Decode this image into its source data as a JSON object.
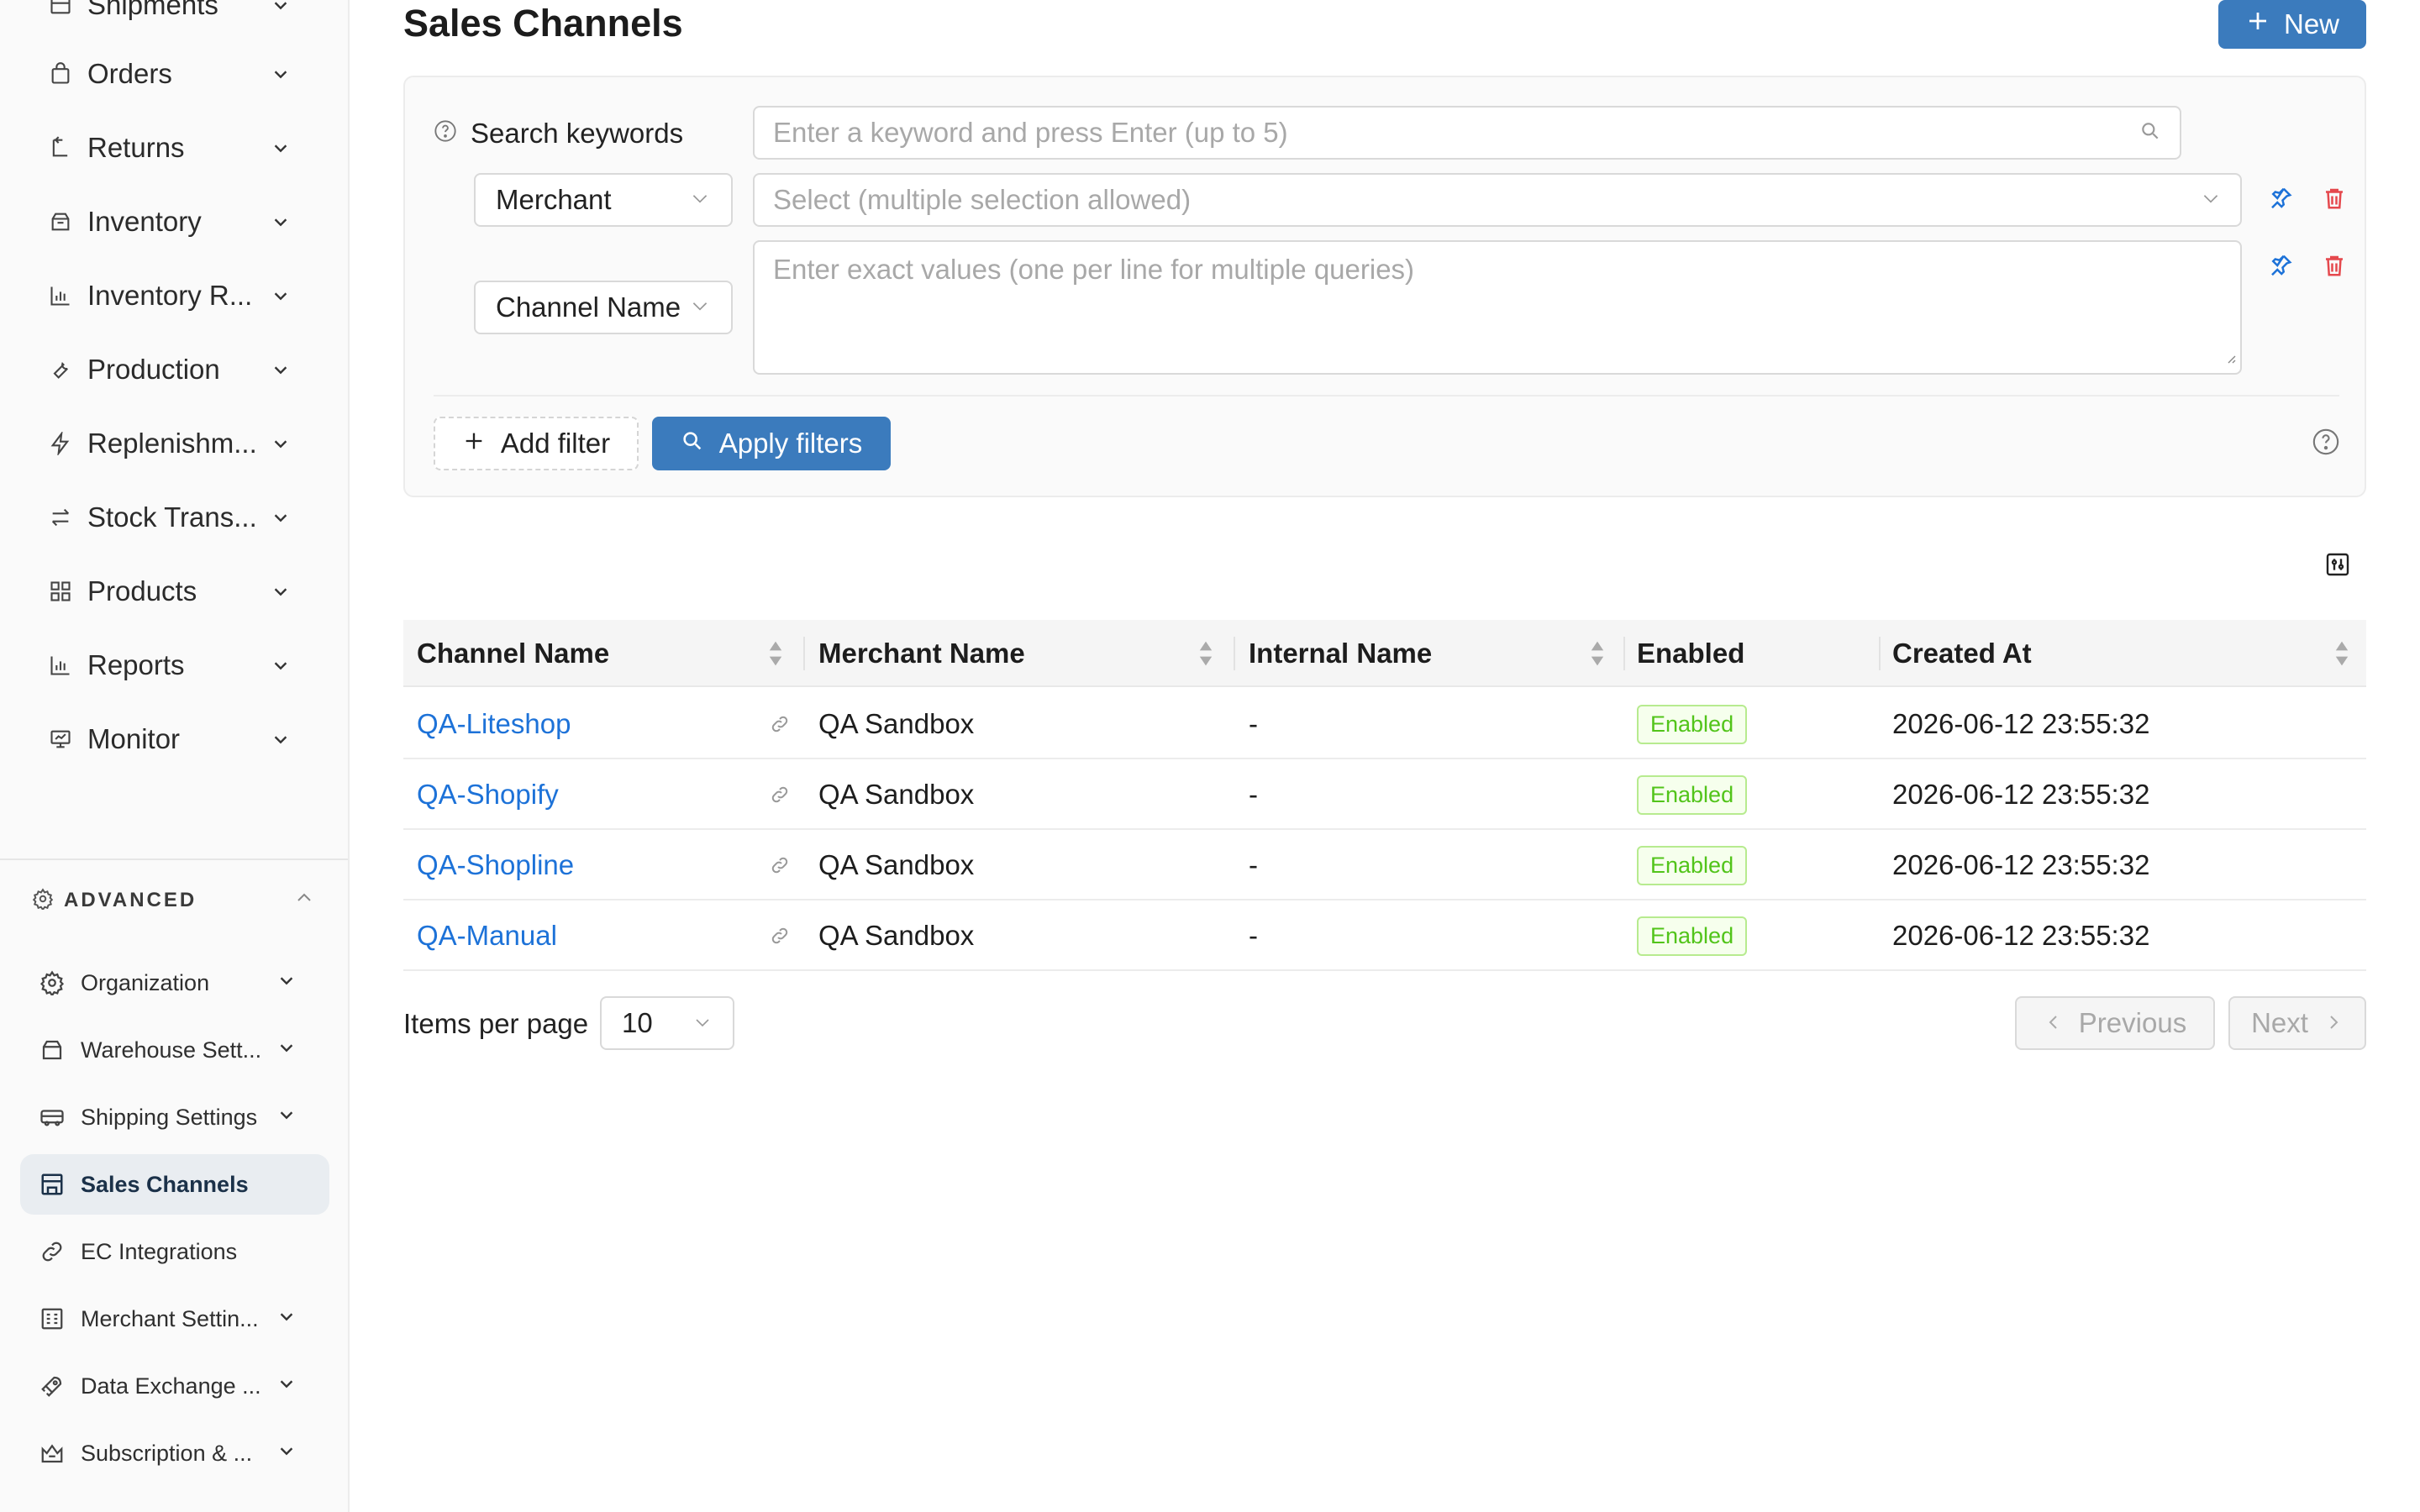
{
  "sidebar": {
    "items": [
      {
        "label": "Shipments",
        "icon": "shipments-icon"
      },
      {
        "label": "Orders",
        "icon": "bag-icon"
      },
      {
        "label": "Returns",
        "icon": "return-icon"
      },
      {
        "label": "Inventory",
        "icon": "box-icon"
      },
      {
        "label": "Inventory R...",
        "icon": "bar-chart-icon"
      },
      {
        "label": "Production",
        "icon": "wrench-icon"
      },
      {
        "label": "Replenishm...",
        "icon": "bolt-icon"
      },
      {
        "label": "Stock Trans...",
        "icon": "transfer-icon"
      },
      {
        "label": "Products",
        "icon": "grid-icon"
      },
      {
        "label": "Reports",
        "icon": "bar-chart-icon"
      },
      {
        "label": "Monitor",
        "icon": "monitor-icon"
      }
    ],
    "advanced_label": "ADVANCED",
    "advanced_items": [
      {
        "label": "Organization",
        "icon": "gear-icon",
        "chevron": true
      },
      {
        "label": "Warehouse Sett...",
        "icon": "warehouse-icon",
        "chevron": true
      },
      {
        "label": "Shipping Settings",
        "icon": "truck-icon",
        "chevron": true
      },
      {
        "label": "Sales Channels",
        "icon": "store-icon",
        "chevron": false,
        "active": true
      },
      {
        "label": "EC Integrations",
        "icon": "link-icon",
        "chevron": false
      },
      {
        "label": "Merchant Settin...",
        "icon": "merchant-icon",
        "chevron": true
      },
      {
        "label": "Data Exchange ...",
        "icon": "rocket-icon",
        "chevron": true
      },
      {
        "label": "Subscription & ...",
        "icon": "crown-icon",
        "chevron": true
      }
    ]
  },
  "header": {
    "title": "Sales Channels",
    "new_label": "New"
  },
  "filters": {
    "keywords_label": "Search keywords",
    "keywords_placeholder": "Enter a keyword and press Enter (up to 5)",
    "merchant_field": "Merchant",
    "merchant_placeholder": "Select (multiple selection allowed)",
    "channel_field": "Channel Name",
    "channel_placeholder": "Enter exact values (one per line for multiple queries)",
    "add_filter_label": "Add filter",
    "apply_label": "Apply filters"
  },
  "table": {
    "columns": [
      "Channel Name",
      "Merchant Name",
      "Internal Name",
      "Enabled",
      "Created At"
    ],
    "rows": [
      {
        "channel": "QA-Liteshop",
        "merchant": "QA Sandbox",
        "internal": "-",
        "enabled": "Enabled",
        "created": "2026-06-12 23:55:32"
      },
      {
        "channel": "QA-Shopify",
        "merchant": "QA Sandbox",
        "internal": "-",
        "enabled": "Enabled",
        "created": "2026-06-12 23:55:32"
      },
      {
        "channel": "QA-Shopline",
        "merchant": "QA Sandbox",
        "internal": "-",
        "enabled": "Enabled",
        "created": "2026-06-12 23:55:32"
      },
      {
        "channel": "QA-Manual",
        "merchant": "QA Sandbox",
        "internal": "-",
        "enabled": "Enabled",
        "created": "2026-06-12 23:55:32"
      }
    ]
  },
  "pagination": {
    "items_per_page_label": "Items per page",
    "page_size": "10",
    "previous_label": "Previous",
    "next_label": "Next"
  },
  "colors": {
    "primary": "#3b7bbd",
    "link": "#1d72d8",
    "success": "#52c41a",
    "danger": "#e5484d"
  }
}
